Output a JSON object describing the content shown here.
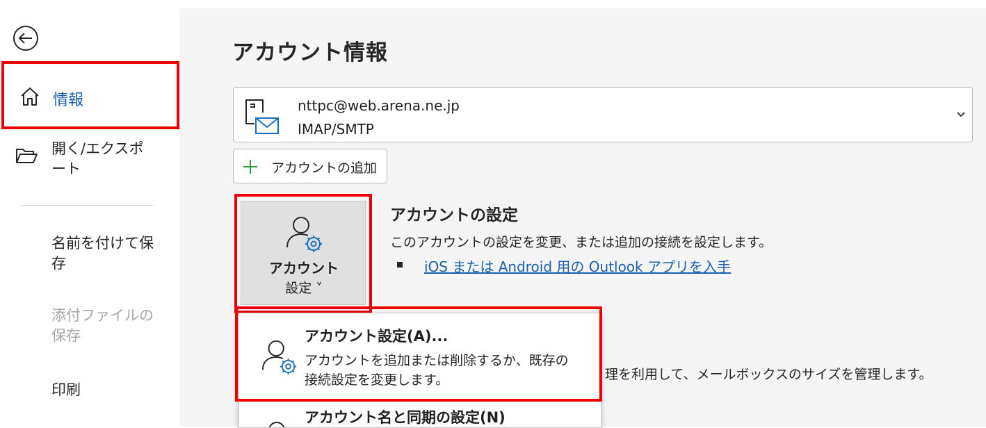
{
  "sidebar": {
    "info_label": "情報",
    "open_export_label": "開く/エクスポート",
    "save_as_label": "名前を付けて保存",
    "save_attachments_label": "添付ファイルの保存",
    "print_label": "印刷"
  },
  "main": {
    "title": "アカウント情報",
    "account": {
      "email": "nttpc@web.arena.ne.jp",
      "type": "IMAP/SMTP"
    },
    "add_account_label": "アカウントの追加",
    "account_settings_button": {
      "line1": "アカウント",
      "line2": "設定 ˅"
    },
    "account_settings_section": {
      "title": "アカウントの設定",
      "description": "このアカウントの設定を変更、または追加の接続を設定します。",
      "link": "iOS または Android 用の Outlook アプリを入手"
    },
    "mailbox_text_partial": "理を利用して、メールボックスのサイズを管理します。"
  },
  "menu": {
    "item1_title": "アカウント設定(A)...",
    "item1_desc": "アカウントを追加または削除するか、既存の接続設定を変更します。",
    "item2_title": "アカウント名と同期の設定(N)"
  },
  "colors": {
    "highlight_red": "#ee0000",
    "accent_blue": "#1a5fb4",
    "main_bg": "#f5f5f5"
  },
  "icons": [
    "back-arrow-icon",
    "home-icon",
    "folder-open-icon",
    "mail-account-icon",
    "chevron-down-icon",
    "plus-icon",
    "person-gear-icon"
  ]
}
